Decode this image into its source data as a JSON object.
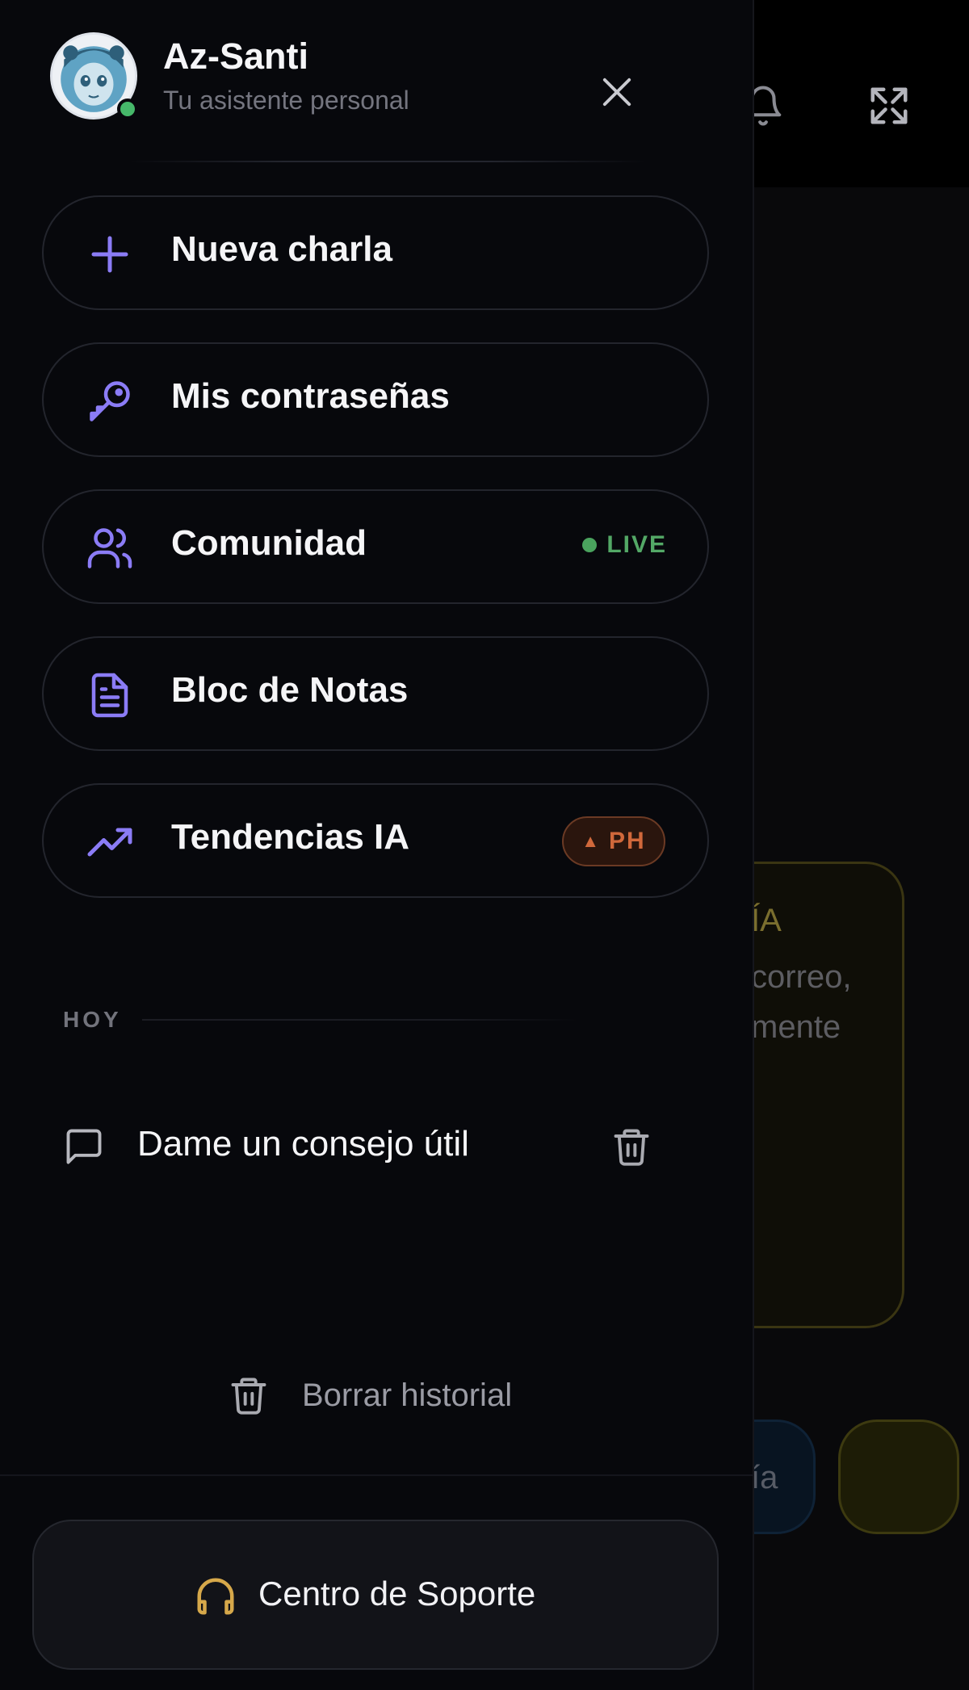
{
  "drawer": {
    "app_name": "Az-Santi",
    "app_subtitle": "Tu asistente personal",
    "status": "online",
    "menu": [
      {
        "label": "Nueva charla",
        "icon": "plus-icon"
      },
      {
        "label": "Mis contraseñas",
        "icon": "key-icon"
      },
      {
        "label": "Comunidad",
        "icon": "users-icon",
        "badge": "LIVE"
      },
      {
        "label": "Bloc de Notas",
        "icon": "document-icon"
      },
      {
        "label": "Tendencias IA",
        "icon": "trending-up-icon",
        "badge": "PH",
        "badge_arrow": "▲"
      }
    ],
    "history_section_label": "HOY",
    "history": [
      {
        "title": "Dame un consejo útil",
        "icon": "chat-bubble-icon"
      }
    ],
    "clear_history_label": "Borrar historial",
    "support_label": "Centro de Soporte"
  },
  "background": {
    "card_title": "ÍA",
    "card_line1": "correo,",
    "card_line2": "mente",
    "chip_label": "ía"
  },
  "colors": {
    "accent_purple": "#8b7cf6",
    "live_green": "#53a866",
    "ph_orange": "#d0683b",
    "support_gold": "#d6a84a",
    "drawer_bg": "#07080c"
  }
}
